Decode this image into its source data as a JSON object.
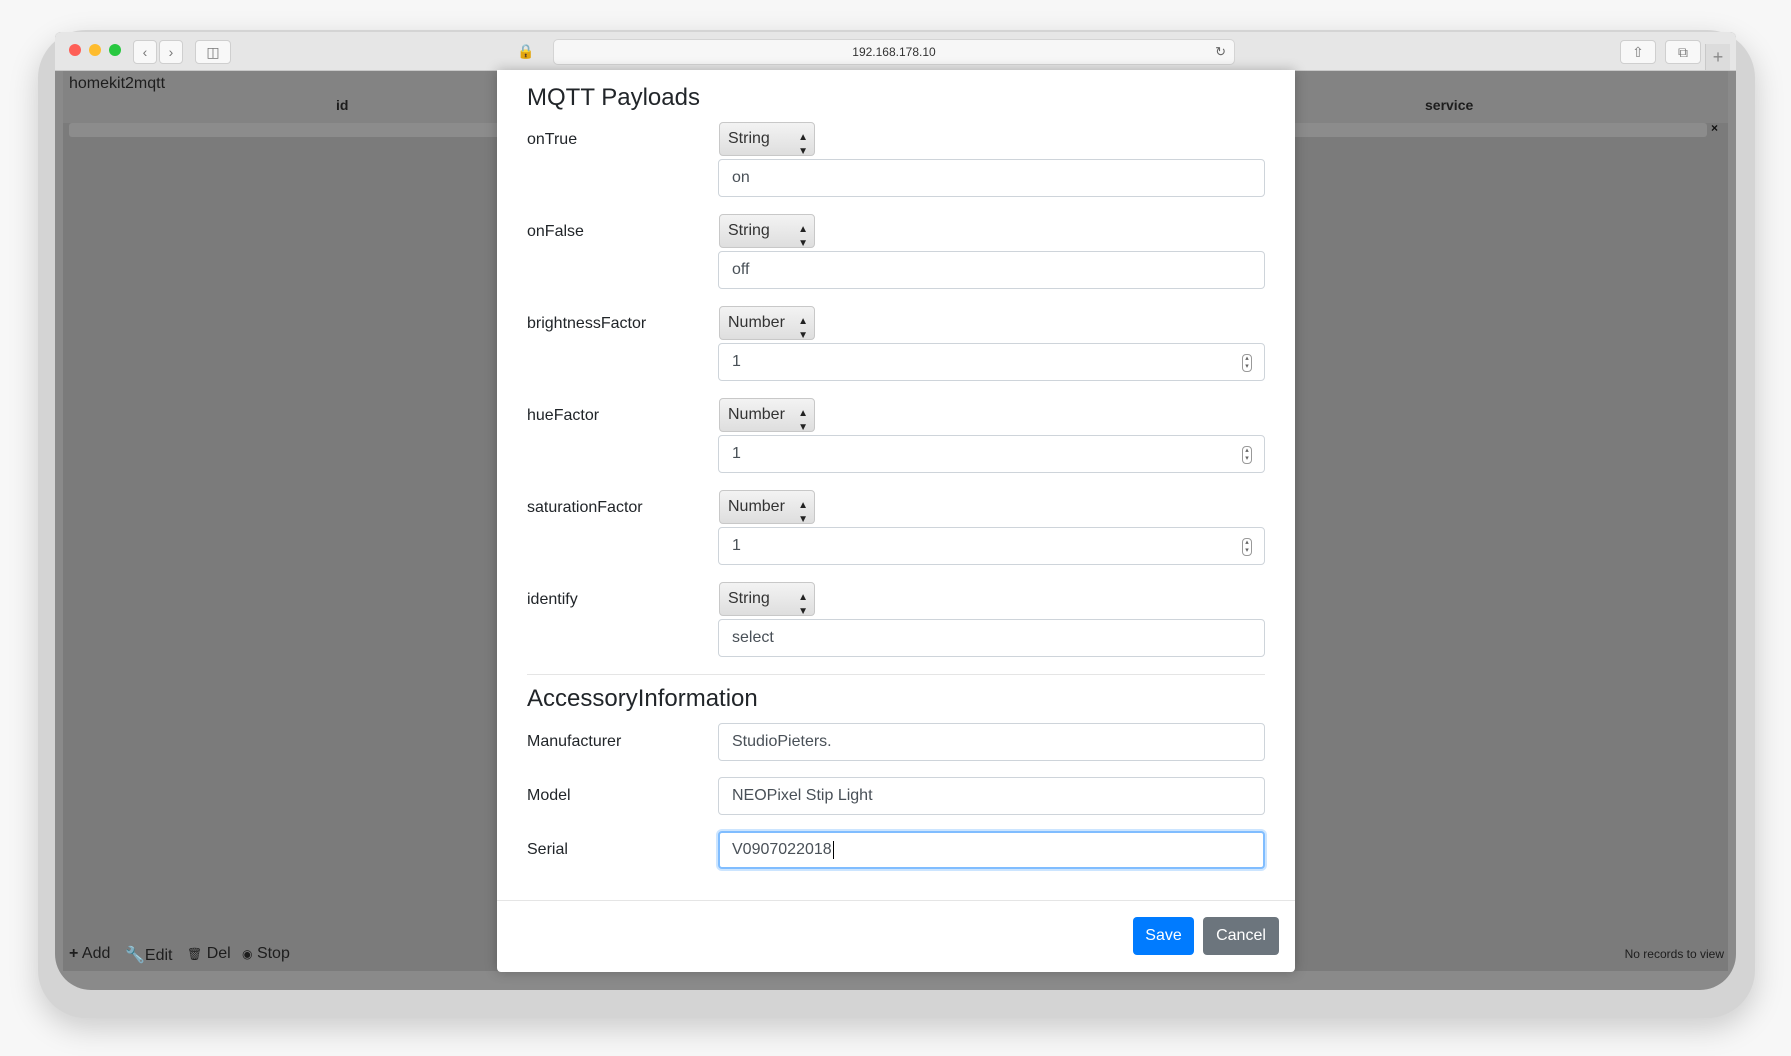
{
  "browser": {
    "address": "192.168.178.10"
  },
  "app": {
    "title": "homekit2mqtt",
    "columns": [
      "id",
      "service"
    ],
    "filter_clear": "×",
    "footer": {
      "add": "Add",
      "edit": "Edit",
      "del": "Del",
      "stop": "Stop",
      "status": "No records to view"
    }
  },
  "modal": {
    "mqtt_section_title": "MQTT Payloads",
    "payloads": [
      {
        "label": "onTrue",
        "type": "String",
        "value": "on",
        "numeric": false
      },
      {
        "label": "onFalse",
        "type": "String",
        "value": "off",
        "numeric": false
      },
      {
        "label": "brightnessFactor",
        "type": "Number",
        "value": "1",
        "numeric": true
      },
      {
        "label": "hueFactor",
        "type": "Number",
        "value": "1",
        "numeric": true
      },
      {
        "label": "saturationFactor",
        "type": "Number",
        "value": "1",
        "numeric": true
      },
      {
        "label": "identify",
        "type": "String",
        "value": "select",
        "numeric": false
      }
    ],
    "accessory_section_title": "AccessoryInformation",
    "accessory": {
      "manufacturer_label": "Manufacturer",
      "manufacturer_value": "StudioPieters.",
      "model_label": "Model",
      "model_value": "NEOPixel Stip Light",
      "serial_label": "Serial",
      "serial_value": "V0907022018"
    },
    "save_label": "Save",
    "cancel_label": "Cancel"
  }
}
